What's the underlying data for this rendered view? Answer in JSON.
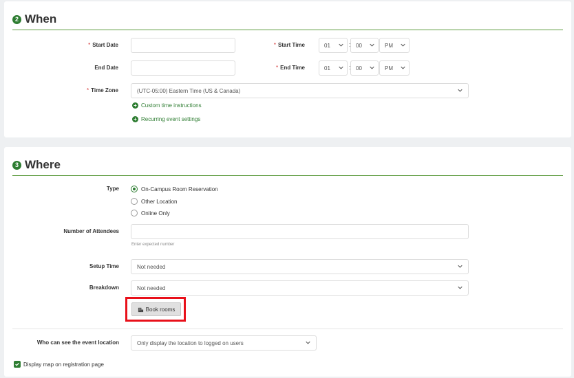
{
  "when": {
    "step": "2",
    "title": "When",
    "start_date_label": "Start Date",
    "end_date_label": "End Date",
    "start_time_label": "Start Time",
    "end_time_label": "End Time",
    "time_zone_label": "Time Zone",
    "start_date_value": "",
    "end_date_value": "",
    "start_time": {
      "hour": "01",
      "minute": "00",
      "ampm": "PM"
    },
    "end_time": {
      "hour": "01",
      "minute": "00",
      "ampm": "PM"
    },
    "time_zone_value": "(UTC-05:00) Eastern Time (US & Canada)",
    "custom_time_link": "Custom time instructions",
    "recurring_link": "Recurring event settings"
  },
  "where": {
    "step": "3",
    "title": "Where",
    "type_label": "Type",
    "type_options": [
      "On-Campus Room Reservation",
      "Other Location",
      "Online Only"
    ],
    "type_selected": "On-Campus Room Reservation",
    "attendees_label": "Number of Attendees",
    "attendees_value": "",
    "attendees_help": "Enter expected number",
    "setup_label": "Setup Time",
    "setup_value": "Not needed",
    "breakdown_label": "Breakdown",
    "breakdown_value": "Not needed",
    "book_rooms_label": "Book rooms",
    "visibility_label": "Who can see the event location",
    "visibility_value": "Only display the location to logged on users",
    "map_checkbox_label": "Display map on registration page",
    "map_checkbox_checked": true
  },
  "colors": {
    "accent_green": "#2e7d32",
    "required_red": "#d32f2f",
    "highlight_red": "#e8101a"
  }
}
